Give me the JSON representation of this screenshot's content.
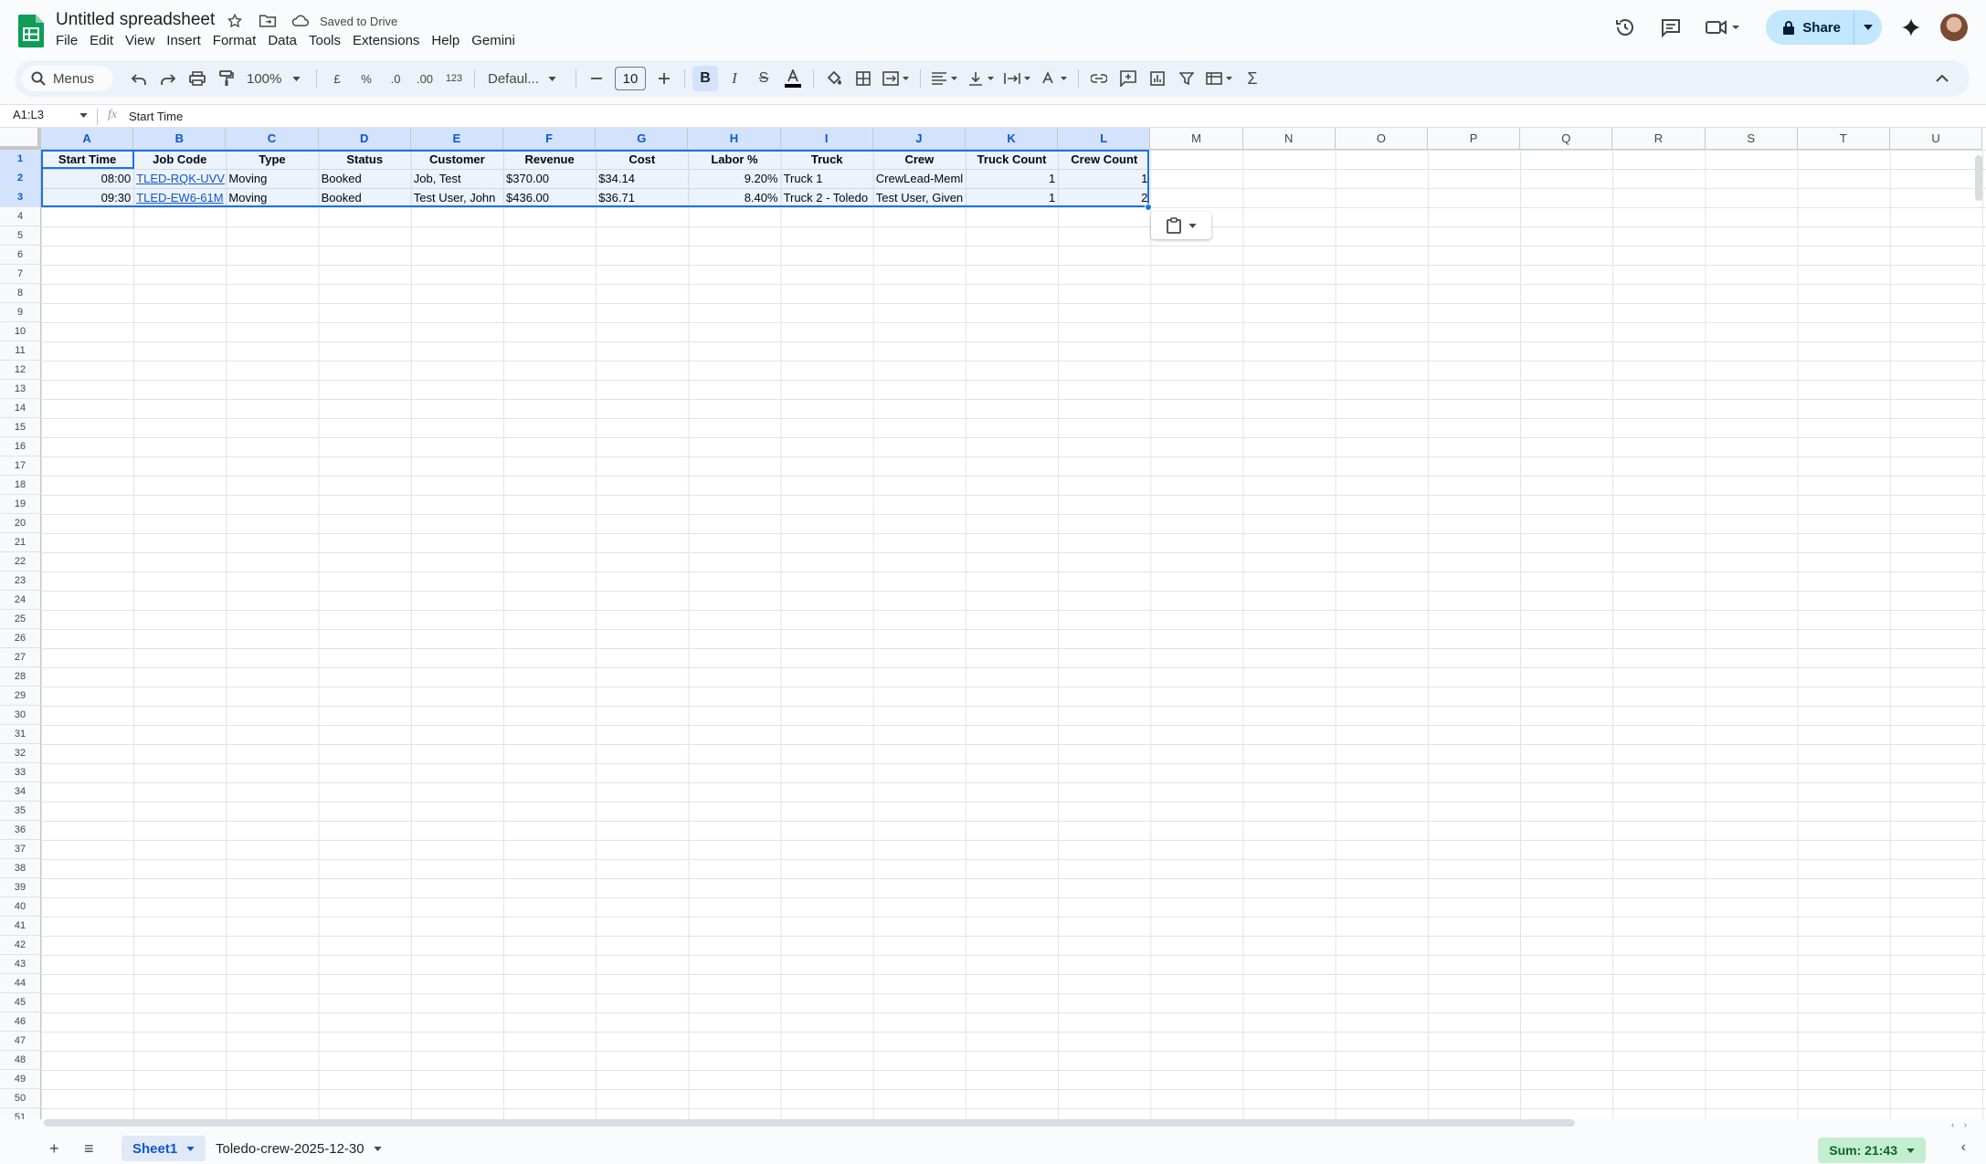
{
  "app": {
    "title": "Untitled spreadsheet",
    "save_status": "Saved to Drive",
    "menu": [
      "File",
      "Edit",
      "View",
      "Insert",
      "Format",
      "Data",
      "Tools",
      "Extensions",
      "Help",
      "Gemini"
    ],
    "share_label": "Share"
  },
  "toolbar": {
    "search_label": "Menus",
    "zoom": "100%",
    "currency": "£",
    "percent": "%",
    "dec_decrease": ".0",
    "dec_increase": ".00",
    "number_format": "123",
    "font": "Defaul...",
    "font_size": "10",
    "bold": "B"
  },
  "formula_bar": {
    "name_box": "A1:L3",
    "fx": "fx",
    "value": "Start Time"
  },
  "grid": {
    "columns": [
      "A",
      "B",
      "C",
      "D",
      "E",
      "F",
      "G",
      "H",
      "I",
      "J",
      "K",
      "L",
      "M",
      "N",
      "O",
      "P",
      "Q",
      "R",
      "S",
      "T",
      "U"
    ],
    "selected_columns": 12,
    "rows_shown": 51,
    "selected_rows": 3,
    "header": [
      "Start Time",
      "Job Code",
      "Type",
      "Status",
      "Customer",
      "Revenue",
      "Cost",
      "Labor %",
      "Truck",
      "Crew",
      "Truck Count",
      "Crew Count"
    ],
    "data": [
      [
        "08:00",
        "TLED-RQK-UVV",
        "Moving",
        "Booked",
        "Job, Test",
        "$370.00",
        "$34.14",
        "9.20%",
        "Truck 1",
        "CrewLead-Meml",
        "1",
        "1"
      ],
      [
        "09:30",
        "TLED-EW6-61M",
        "Moving",
        "Booked",
        "Test User, John",
        "$436.00",
        "$36.71",
        "8.40%",
        "Truck 2 - Toledo",
        "Test User, Given",
        "1",
        "2"
      ]
    ],
    "right_aligned_cols": [
      0,
      7,
      10,
      11
    ],
    "link_cols": [
      1
    ]
  },
  "sheets": {
    "tabs": [
      "Sheet1",
      "Toledo-crew-2025-12-30"
    ],
    "active": 0,
    "sum": "Sum: 21:43"
  }
}
